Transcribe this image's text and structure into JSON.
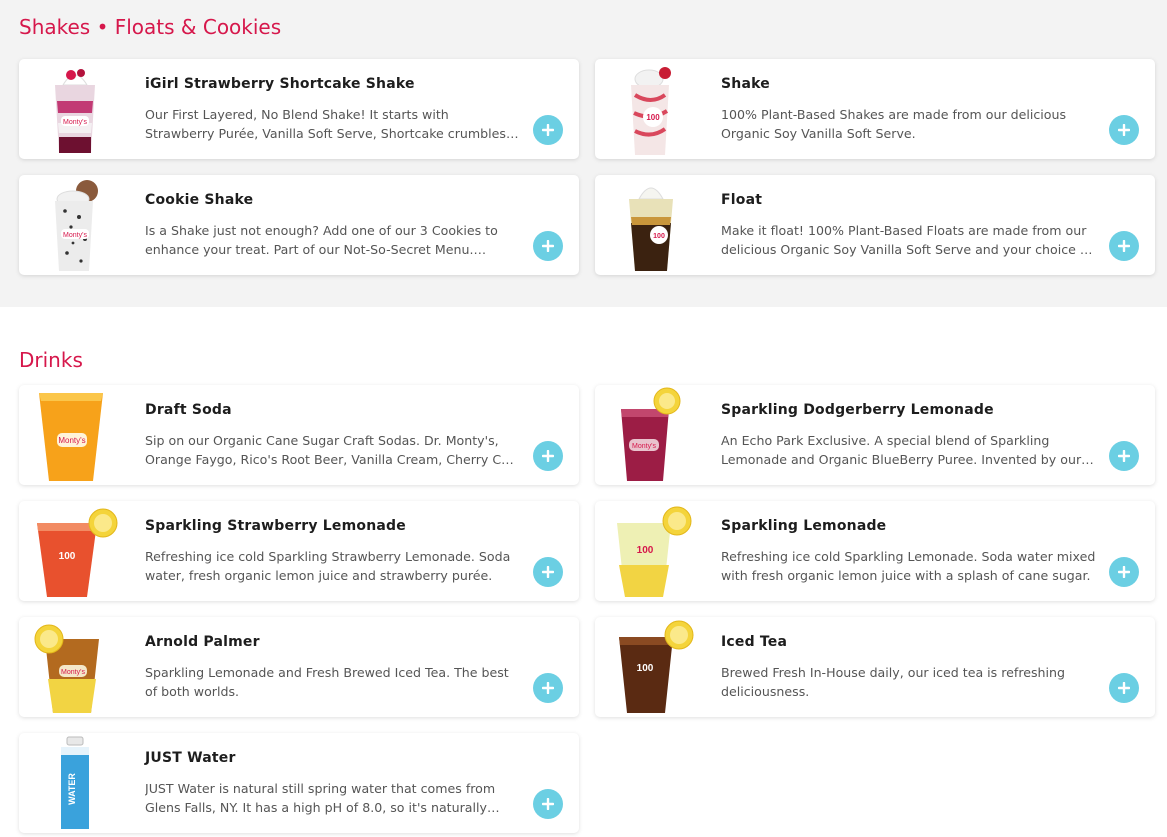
{
  "colors": {
    "accent": "#d6174b",
    "add_button": "#6bcfe3"
  },
  "sections": [
    {
      "title": "Shakes • Floats & Cookies",
      "items": [
        {
          "name": "iGirl Strawberry Shortcake Shake",
          "description": "Our First Layered, No Blend Shake! It starts with Strawberry Purée, Vanilla Soft Serve, Shortcake crumbles and more strawberry goodness layered all the way up.",
          "image_icon": "layered-strawberry-shake"
        },
        {
          "name": "Shake",
          "description": "100% Plant-Based Shakes are made from our delicious Organic Soy Vanilla Soft Serve.",
          "image_icon": "strawberry-swirl-shake"
        },
        {
          "name": "Cookie Shake",
          "description": "Is a Shake just not enough? Add one of our 3 Cookies to enhance your treat. Part of our Not-So-Secret Menu. Choose your cookie and shake flavor.",
          "image_icon": "cookies-and-cream-shake"
        },
        {
          "name": "Float",
          "description": "Make it float! 100% Plant-Based Floats are made from our delicious Organic Soy Vanilla Soft Serve and your choice of craft soda.",
          "image_icon": "root-beer-float"
        }
      ]
    },
    {
      "title": "Drinks",
      "items": [
        {
          "name": "Draft Soda",
          "description": "Sip on our Organic Cane Sugar Craft Sodas. Dr. Monty's, Orange Faygo, Rico's Root Beer, Vanilla Cream, Cherry Cola and more rotating flavors.",
          "image_icon": "orange-soda-cup"
        },
        {
          "name": "Sparkling Dodgerberry Lemonade",
          "description": "An Echo Park Exclusive. A special blend of Sparkling Lemonade and Organic BlueBerry Puree. Invented by our Echo Park crew.",
          "image_icon": "berry-lemonade-cup"
        },
        {
          "name": "Sparkling Strawberry Lemonade",
          "description": "Refreshing ice cold Sparkling Strawberry Lemonade. Soda water, fresh organic lemon juice and strawberry purée.",
          "image_icon": "strawberry-lemonade-cup"
        },
        {
          "name": "Sparkling Lemonade",
          "description": "Refreshing ice cold Sparkling Lemonade. Soda water mixed with fresh organic lemon juice with a splash of cane sugar.",
          "image_icon": "lemonade-cup"
        },
        {
          "name": "Arnold Palmer",
          "description": "Sparkling Lemonade and Fresh Brewed Iced Tea. The best of both worlds.",
          "image_icon": "arnold-palmer-cup"
        },
        {
          "name": "Iced Tea",
          "description": "Brewed Fresh In-House daily, our iced tea is refreshing deliciousness.",
          "image_icon": "iced-tea-cup"
        },
        {
          "name": "JUST Water",
          "description": "JUST Water is natural still spring water that comes from Glens Falls, NY. It has a high pH of 8.0, so it's naturally alkaline.",
          "image_icon": "water-carton"
        }
      ]
    }
  ]
}
